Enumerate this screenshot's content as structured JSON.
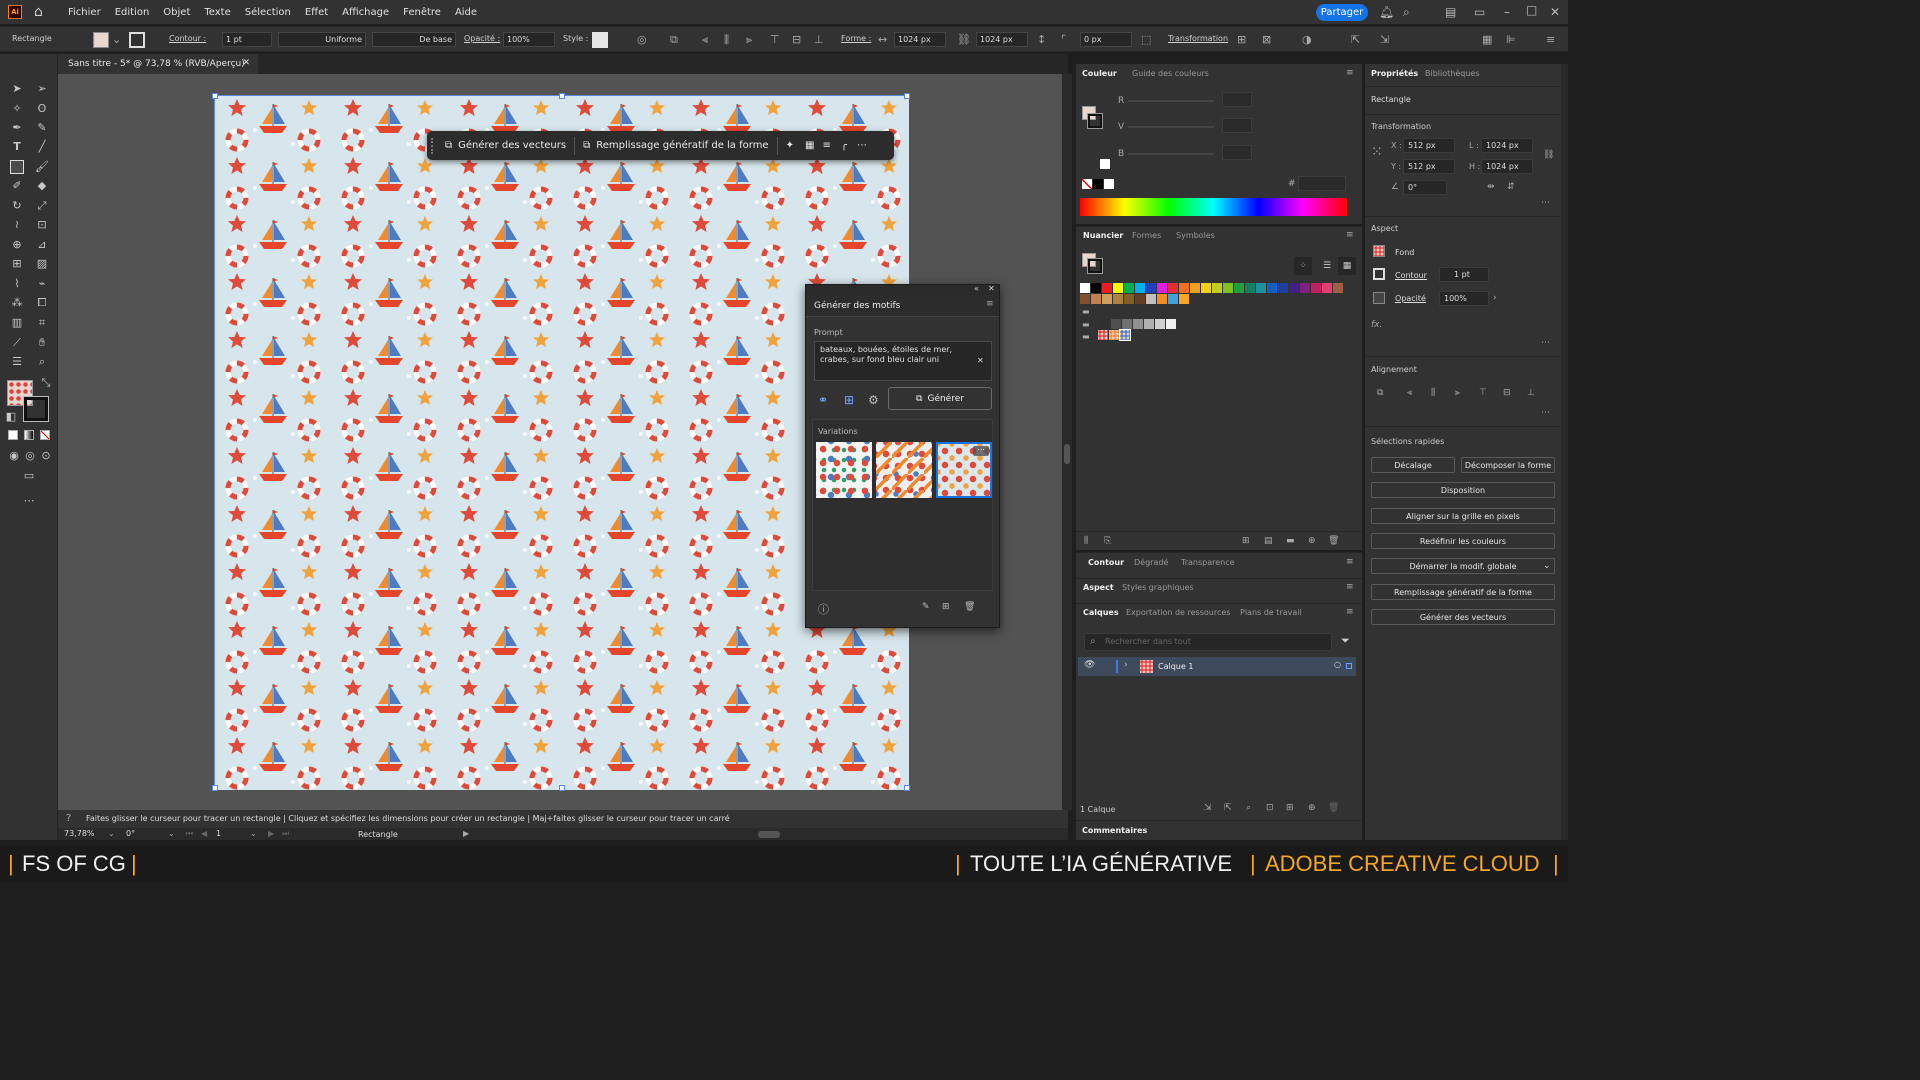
{
  "menubar": {
    "app_logo": "Ai",
    "items": [
      "Fichier",
      "Edition",
      "Objet",
      "Texte",
      "Sélection",
      "Effet",
      "Affichage",
      "Fenêtre",
      "Aide"
    ],
    "share_label": "Partager"
  },
  "control_bar": {
    "object_type": "Rectangle",
    "contour_label": "Contour :",
    "stroke_weight": "1 pt",
    "stroke_style": "Uniforme",
    "brush": "De base",
    "opacity_label": "Opacité :",
    "opacity": "100%",
    "style_label": "Style :",
    "shape_label": "Forme :",
    "width": "1024 px",
    "height": "1024 px",
    "corner": "0 px",
    "transform_label": "Transformation"
  },
  "document": {
    "tab_title": "Sans titre - 5* @ 73,78 % (RVB/Aperçu)"
  },
  "context_bar": {
    "generate_vectors": "Générer des vecteurs",
    "generative_fill": "Remplissage génératif de la forme"
  },
  "pattern_panel": {
    "title": "Générer des motifs",
    "prompt_label": "Prompt",
    "prompt_text": "bateaux, bouées, étoiles de mer, crabes, sur fond bleu clair uni",
    "generate_label": "Générer",
    "variations_label": "Variations"
  },
  "color_panel": {
    "tabs": [
      "Couleur",
      "Guide des couleurs"
    ],
    "channels": [
      "R",
      "V",
      "B"
    ],
    "hex_prefix": "#"
  },
  "swatches_panel": {
    "tabs": [
      "Nuancier",
      "Formes",
      "Symboles"
    ],
    "colors": [
      "#ffffff",
      "#000000",
      "#e62020",
      "#ffff00",
      "#00b050",
      "#00b0f0",
      "#2040c0",
      "#e020e0",
      "#e03030",
      "#f07020",
      "#f0a020",
      "#f0d020",
      "#c0d020",
      "#80c020",
      "#20a040",
      "#108060",
      "#2090a0",
      "#1060c0",
      "#2040a0",
      "#402080",
      "#802080",
      "#c02060",
      "#e04070",
      "#a06040",
      "#805030",
      "#c08050",
      "#d0a060",
      "#b08040",
      "#806020",
      "#604020",
      "#c0c0c0",
      "#f09020",
      "#40a0e0",
      "#f5a623"
    ],
    "grays": [
      "#303030",
      "#505050",
      "#707070",
      "#909090",
      "#b0b0b0",
      "#d0d0d0",
      "#f0f0f0"
    ]
  },
  "lower_panels": {
    "contour_tabs": [
      "Contour",
      "Dégradé",
      "Transparence"
    ],
    "aspect_tabs": [
      "Aspect",
      "Styles graphiques"
    ],
    "layers_tabs": [
      "Calques",
      "Exportation de ressources",
      "Plans de travail"
    ],
    "search_placeholder": "Rechercher dans tout",
    "layer_name": "Calque 1",
    "layer_count": "1 Calque",
    "comments": "Commentaires"
  },
  "properties": {
    "tabs": [
      "Propriétés",
      "Bibliothèques"
    ],
    "object_type": "Rectangle",
    "transform_title": "Transformation",
    "x": "512 px",
    "y": "512 px",
    "w": "1024 px",
    "h": "1024 px",
    "angle": "0°",
    "aspect_title": "Aspect",
    "fill_label": "Fond",
    "stroke_label": "Contour",
    "stroke_weight": "1 pt",
    "opacity_label": "Opacité",
    "opacity": "100%",
    "fx": "fx.",
    "align_title": "Alignement",
    "quick_title": "Sélections rapides",
    "buttons": {
      "offset": "Décalage",
      "expand_shape": "Décomposer la forme",
      "arrange": "Disposition",
      "pixel_grid": "Aligner sur la grille en pixels",
      "recolor": "Redéfinir les couleurs",
      "global_edit": "Démarrer la modif. globale",
      "gen_fill": "Remplissage génératif de la forme",
      "gen_vectors": "Générer des vecteurs"
    }
  },
  "statusbar": {
    "hint": "Faites glisser le curseur pour tracer un rectangle  |  Cliquez et spécifiez les dimensions pour créer un rectangle  |  Maj+faites glisser le curseur pour tracer un carré",
    "zoom": "73,78%",
    "rotation": "0°",
    "artboard": "1",
    "tool": "Rectangle"
  },
  "banner": {
    "left": "FS OF CG",
    "right_white": "TOUTE L’IA GÉNÉRATIVE",
    "right_orange": "ADOBE CREATIVE CLOUD"
  }
}
